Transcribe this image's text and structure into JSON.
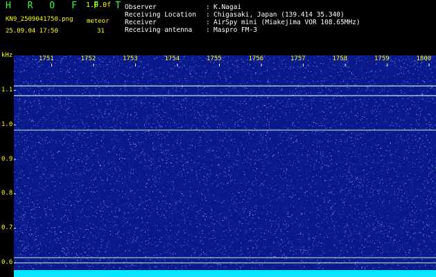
{
  "header": {
    "app_name": "H R O F F T",
    "version": "1.0.0f",
    "filename": "KN9_2509041750.png",
    "datetime": "25.09.04 17:50",
    "meteor_label": "meteor",
    "meteor_count": "31",
    "info": [
      {
        "label": "Observer",
        "value": "K.Nagai"
      },
      {
        "label": "Receiving Location",
        "value": "Chigasaki, Japan (139.414 35.340)"
      },
      {
        "label": "Receiver",
        "value": "AirSpy mini (Miakejima VOR 108.65MHz)"
      },
      {
        "label": "Receiving antenna",
        "value": "Maspro FM-3"
      }
    ]
  },
  "spectrogram": {
    "y_unit": "kHz",
    "x_ticks": [
      "1751",
      "1752",
      "1753",
      "1754",
      "1755",
      "1756",
      "1757",
      "1758",
      "1759",
      "1800"
    ],
    "y_ticks": [
      "1.1",
      "1.0",
      "0.9",
      "0.8",
      "0.7",
      "0.6"
    ],
    "colors": {
      "background": "#0b1a8a",
      "noise_light": "#5f8fff",
      "noise_cyan": "#8fd8ff",
      "line": "#c8ffd8",
      "floor": "#00e8ff"
    },
    "horizontal_lines_khz": [
      1.113,
      1.085,
      0.985,
      0.615,
      0.6
    ]
  }
}
